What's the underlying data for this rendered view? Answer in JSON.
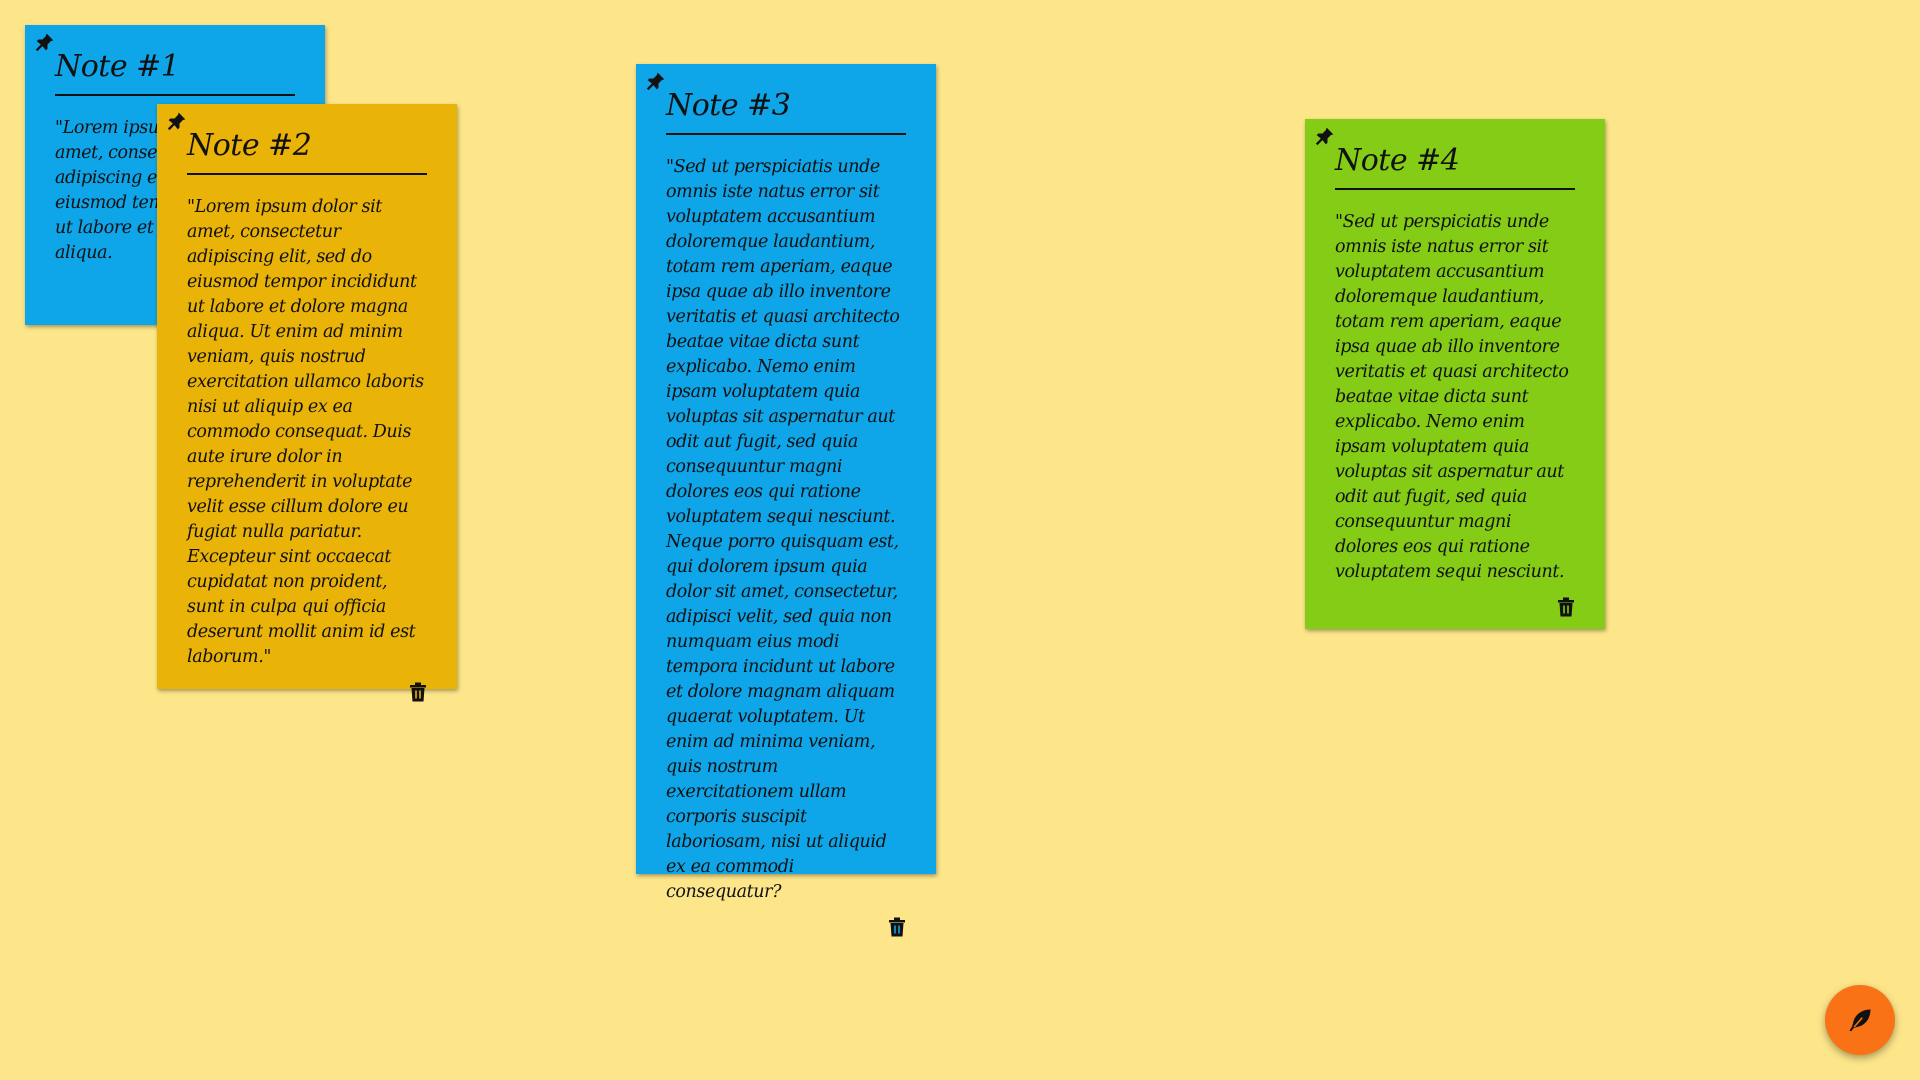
{
  "colors": {
    "background": "#fde68a",
    "blue": "#0ea5e9",
    "amber": "#eab308",
    "green": "#84cc16",
    "fab": "#f97316"
  },
  "notes": [
    {
      "title": "Note #1",
      "color": "#0ea5e9",
      "text": "\"Lorem ipsum dolor sit amet, consectetur adipiscing elit, sed do eiusmod tempor incididunt ut labore et dolore magna aliqua.",
      "pinned": true
    },
    {
      "title": "Note #2",
      "color": "#eab308",
      "text": "\"Lorem ipsum dolor sit amet, consectetur adipiscing elit, sed do eiusmod tempor incididunt ut labore et dolore magna aliqua. Ut enim ad minim veniam, quis nostrud exercitation ullamco laboris nisi ut aliquip ex ea commodo consequat. Duis aute irure dolor in reprehenderit in voluptate velit esse cillum dolore eu fugiat nulla pariatur. Excepteur sint occaecat cupidatat non proident, sunt in culpa qui officia deserunt mollit anim id est laborum.\"",
      "pinned": true
    },
    {
      "title": "Note #3",
      "color": "#0ea5e9",
      "text": "\"Sed ut perspiciatis unde omnis iste natus error sit voluptatem accusantium doloremque laudantium, totam rem aperiam, eaque ipsa quae ab illo inventore veritatis et quasi architecto beatae vitae dicta sunt explicabo. Nemo enim ipsam voluptatem quia voluptas sit aspernatur aut odit aut fugit, sed quia consequuntur magni dolores eos qui ratione voluptatem sequi nesciunt. Neque porro quisquam est, qui dolorem ipsum quia dolor sit amet, consectetur, adipisci velit, sed quia non numquam eius modi tempora incidunt ut labore et dolore magnam aliquam quaerat voluptatem. Ut enim ad minima veniam, quis nostrum exercitationem ullam corporis suscipit laboriosam, nisi ut aliquid ex ea commodi consequatur?",
      "pinned": true
    },
    {
      "title": "Note #4",
      "color": "#84cc16",
      "text": "\"Sed ut perspiciatis unde omnis iste natus error sit voluptatem accusantium doloremque laudantium, totam rem aperiam, eaque ipsa quae ab illo inventore veritatis et quasi architecto beatae vitae dicta sunt explicabo. Nemo enim ipsam voluptatem quia voluptas sit aspernatur aut odit aut fugit, sed quia consequuntur magni dolores eos qui ratione voluptatem sequi nesciunt.",
      "pinned": true
    }
  ],
  "icons": {
    "pin": "pin-icon",
    "trash": "trash-icon",
    "fab": "feather-icon"
  }
}
